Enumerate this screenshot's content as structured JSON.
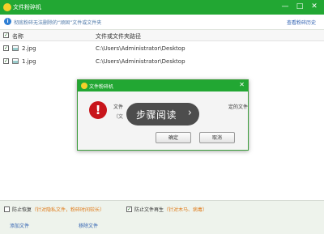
{
  "window": {
    "title": "文件粉碎机",
    "minimize_glyph": "—",
    "maximize_glyph": "□",
    "close_glyph": "✕",
    "icon": "app-logo-icon"
  },
  "infobar": {
    "icon": "info-icon",
    "icon_glyph": "i",
    "text": "彻底粉碎无法删除的“顽固”文件或文件夹",
    "history_link": "查看粉碎历史"
  },
  "table": {
    "header_checked": "✓",
    "columns": {
      "name": "名称",
      "path": "文件或文件夹路径"
    },
    "rows": [
      {
        "checked": "✓",
        "icon": "image-file-icon",
        "name": "2.jpg",
        "path": "C:\\Users\\Administrator\\Desktop"
      },
      {
        "checked": "✓",
        "icon": "image-file-icon",
        "name": "1.jpg",
        "path": "C:\\Users\\Administrator\\Desktop"
      }
    ]
  },
  "dialog": {
    "title": "文件粉碎机",
    "close_glyph": "✕",
    "error_glyph": "!",
    "message_line1": "文件",
    "message_line1_end": "定的文件",
    "message_line2": "（文",
    "ok_button": "确定",
    "cancel_button": "取消"
  },
  "overlay": {
    "label": "步骤阅读",
    "arrow": "›"
  },
  "footer": {
    "option1_label": "防止恢复",
    "option1_note": "（针对隐私文件，粉碎时间较长）",
    "option1_checked": "",
    "option2_label": "防止文件再生",
    "option2_note": "（针对木马、病毒）",
    "option2_checked": "✓",
    "add_file": "添加文件",
    "remove_file": "移除文件"
  }
}
